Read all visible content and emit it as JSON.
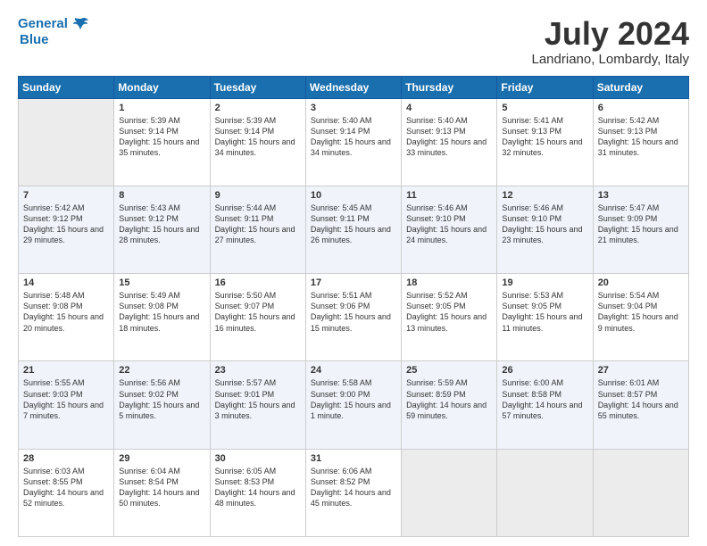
{
  "header": {
    "logo_line1": "General",
    "logo_line2": "Blue",
    "month": "July 2024",
    "location": "Landriano, Lombardy, Italy"
  },
  "weekdays": [
    "Sunday",
    "Monday",
    "Tuesday",
    "Wednesday",
    "Thursday",
    "Friday",
    "Saturday"
  ],
  "weeks": [
    [
      {
        "day": "",
        "empty": true
      },
      {
        "day": "1",
        "rise": "5:39 AM",
        "set": "9:14 PM",
        "daylight": "15 hours and 35 minutes."
      },
      {
        "day": "2",
        "rise": "5:39 AM",
        "set": "9:14 PM",
        "daylight": "15 hours and 34 minutes."
      },
      {
        "day": "3",
        "rise": "5:40 AM",
        "set": "9:14 PM",
        "daylight": "15 hours and 34 minutes."
      },
      {
        "day": "4",
        "rise": "5:40 AM",
        "set": "9:13 PM",
        "daylight": "15 hours and 33 minutes."
      },
      {
        "day": "5",
        "rise": "5:41 AM",
        "set": "9:13 PM",
        "daylight": "15 hours and 32 minutes."
      },
      {
        "day": "6",
        "rise": "5:42 AM",
        "set": "9:13 PM",
        "daylight": "15 hours and 31 minutes."
      }
    ],
    [
      {
        "day": "7",
        "rise": "5:42 AM",
        "set": "9:12 PM",
        "daylight": "15 hours and 29 minutes."
      },
      {
        "day": "8",
        "rise": "5:43 AM",
        "set": "9:12 PM",
        "daylight": "15 hours and 28 minutes."
      },
      {
        "day": "9",
        "rise": "5:44 AM",
        "set": "9:11 PM",
        "daylight": "15 hours and 27 minutes."
      },
      {
        "day": "10",
        "rise": "5:45 AM",
        "set": "9:11 PM",
        "daylight": "15 hours and 26 minutes."
      },
      {
        "day": "11",
        "rise": "5:46 AM",
        "set": "9:10 PM",
        "daylight": "15 hours and 24 minutes."
      },
      {
        "day": "12",
        "rise": "5:46 AM",
        "set": "9:10 PM",
        "daylight": "15 hours and 23 minutes."
      },
      {
        "day": "13",
        "rise": "5:47 AM",
        "set": "9:09 PM",
        "daylight": "15 hours and 21 minutes."
      }
    ],
    [
      {
        "day": "14",
        "rise": "5:48 AM",
        "set": "9:08 PM",
        "daylight": "15 hours and 20 minutes."
      },
      {
        "day": "15",
        "rise": "5:49 AM",
        "set": "9:08 PM",
        "daylight": "15 hours and 18 minutes."
      },
      {
        "day": "16",
        "rise": "5:50 AM",
        "set": "9:07 PM",
        "daylight": "15 hours and 16 minutes."
      },
      {
        "day": "17",
        "rise": "5:51 AM",
        "set": "9:06 PM",
        "daylight": "15 hours and 15 minutes."
      },
      {
        "day": "18",
        "rise": "5:52 AM",
        "set": "9:05 PM",
        "daylight": "15 hours and 13 minutes."
      },
      {
        "day": "19",
        "rise": "5:53 AM",
        "set": "9:05 PM",
        "daylight": "15 hours and 11 minutes."
      },
      {
        "day": "20",
        "rise": "5:54 AM",
        "set": "9:04 PM",
        "daylight": "15 hours and 9 minutes."
      }
    ],
    [
      {
        "day": "21",
        "rise": "5:55 AM",
        "set": "9:03 PM",
        "daylight": "15 hours and 7 minutes."
      },
      {
        "day": "22",
        "rise": "5:56 AM",
        "set": "9:02 PM",
        "daylight": "15 hours and 5 minutes."
      },
      {
        "day": "23",
        "rise": "5:57 AM",
        "set": "9:01 PM",
        "daylight": "15 hours and 3 minutes."
      },
      {
        "day": "24",
        "rise": "5:58 AM",
        "set": "9:00 PM",
        "daylight": "15 hours and 1 minute."
      },
      {
        "day": "25",
        "rise": "5:59 AM",
        "set": "8:59 PM",
        "daylight": "14 hours and 59 minutes."
      },
      {
        "day": "26",
        "rise": "6:00 AM",
        "set": "8:58 PM",
        "daylight": "14 hours and 57 minutes."
      },
      {
        "day": "27",
        "rise": "6:01 AM",
        "set": "8:57 PM",
        "daylight": "14 hours and 55 minutes."
      }
    ],
    [
      {
        "day": "28",
        "rise": "6:03 AM",
        "set": "8:55 PM",
        "daylight": "14 hours and 52 minutes."
      },
      {
        "day": "29",
        "rise": "6:04 AM",
        "set": "8:54 PM",
        "daylight": "14 hours and 50 minutes."
      },
      {
        "day": "30",
        "rise": "6:05 AM",
        "set": "8:53 PM",
        "daylight": "14 hours and 48 minutes."
      },
      {
        "day": "31",
        "rise": "6:06 AM",
        "set": "8:52 PM",
        "daylight": "14 hours and 45 minutes."
      },
      {
        "day": "",
        "empty": true
      },
      {
        "day": "",
        "empty": true
      },
      {
        "day": "",
        "empty": true
      }
    ]
  ]
}
